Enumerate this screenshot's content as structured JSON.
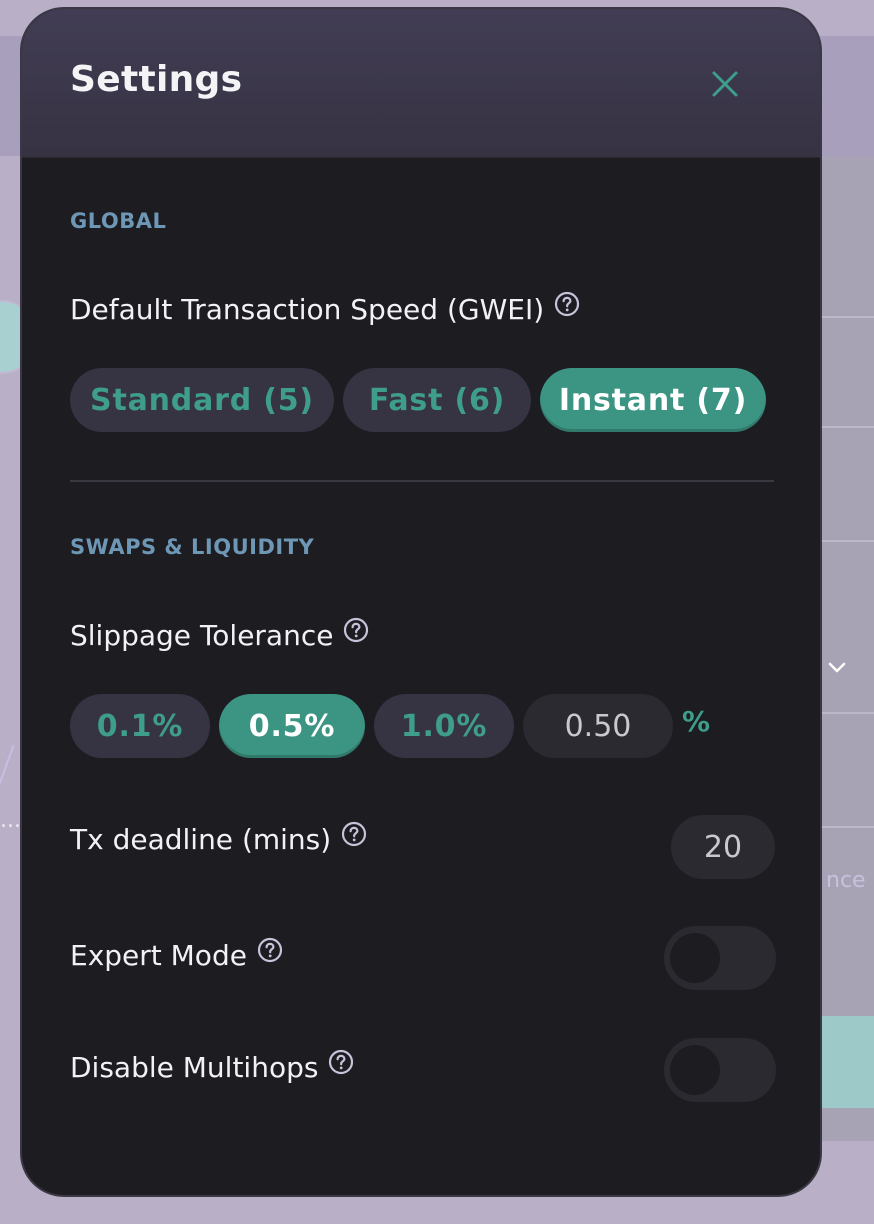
{
  "modal": {
    "title": "Settings"
  },
  "global": {
    "section_label": "GLOBAL",
    "tx_speed_label": "Default Transaction Speed (GWEI)",
    "speed_options": [
      "Standard (5)",
      "Fast (6)",
      "Instant (7)"
    ],
    "selected_speed": "Instant (7)"
  },
  "swaps": {
    "section_label": "SWAPS & LIQUIDITY",
    "slippage_label": "Slippage Tolerance",
    "slippage_options": [
      "0.1%",
      "0.5%",
      "1.0%"
    ],
    "selected_slippage": "0.5%",
    "slippage_custom_value": "0.50",
    "slippage_unit": "%",
    "deadline_label": "Tx deadline (mins)",
    "deadline_value": "20",
    "expert_mode_label": "Expert Mode",
    "expert_mode_on": false,
    "multihops_label": "Disable Multihops",
    "multihops_disabled_on": false
  },
  "background": {
    "partial_text": "nce",
    "ellipsis": "..."
  },
  "colors": {
    "accent": "#3c9483",
    "accent_text": "#3f9d8c",
    "section_label": "#6d97b5",
    "modal_bg": "#1c1c21",
    "pill_bg": "#363343"
  },
  "icons": {
    "close": "close-icon",
    "help": "question-circle-icon",
    "chevron": "chevron-down-icon"
  }
}
